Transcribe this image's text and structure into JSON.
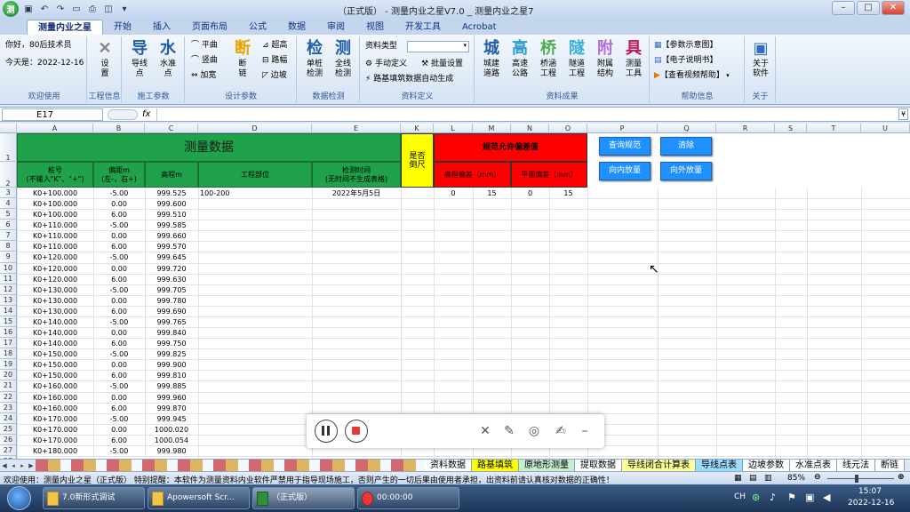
{
  "window": {
    "title": "（正式版） - 测量内业之星V7.0 _ 测量内业之星7",
    "quick_access": [
      "save-icon",
      "undo-icon",
      "redo-icon",
      "folder-icon",
      "printer-icon",
      "preview-icon"
    ],
    "controls": [
      "–",
      "□",
      "✕"
    ]
  },
  "tabs": [
    "测量内业之星",
    "开始",
    "插入",
    "页面布局",
    "公式",
    "数据",
    "审阅",
    "视图",
    "开发工具",
    "Acrobat"
  ],
  "ribbon": {
    "welcome": {
      "line1": "你好，80后技术员",
      "line2": "今天是：2022-12-16",
      "label": "欢迎使用"
    },
    "engineering": {
      "btn": "设\n置",
      "label": "工程信息"
    },
    "survey": {
      "daoxian": "导线\n点",
      "shuizhun": "水准\n点",
      "label": "施工参数"
    },
    "design": {
      "items": [
        "平曲",
        "竖曲",
        "加宽"
      ],
      "duanlian": "断\n链",
      "chaogao": "超高",
      "lufu": "路幅",
      "bianpo": "边坡",
      "label": "设计参数"
    },
    "check": {
      "danzhuang": "单桩\n检测",
      "quanxian": "全线\n检测",
      "label": "数据检测"
    },
    "define": {
      "type_label": "资料类型",
      "manual": "手动定义",
      "batch": "批量设置",
      "auto": "路基填筑数据自动生成",
      "label": "资料定义"
    },
    "results": {
      "items": [
        "城建\n道路",
        "高速\n公路",
        "桥涵\n工程",
        "隧道\n工程",
        "附属\n结构",
        "测量\n工具"
      ],
      "icons": [
        "城",
        "高",
        "桥",
        "隧",
        "附",
        "具"
      ],
      "label": "资料成果"
    },
    "help": {
      "items": [
        "【参数示意图】",
        "【电子说明书】",
        "【查看视频帮助】"
      ],
      "label": "帮助信息"
    },
    "about": {
      "btn": "关于\n软件",
      "label": "关于"
    }
  },
  "formula_bar": {
    "name_box": "E17",
    "fx": "fx",
    "value": ""
  },
  "columns": [
    "A",
    "B",
    "C",
    "D",
    "E",
    "K",
    "L",
    "M",
    "N",
    "O",
    "P",
    "Q",
    "R",
    "S",
    "T",
    "U"
  ],
  "sheet": {
    "title": "测量数据",
    "headers": {
      "station": "桩号\n(不输入\"K\"、\"+\")",
      "offset": "偏距m\n(左-，右+)",
      "elev": "高程m",
      "part": "工程部位",
      "time": "检测时间\n(无时间不生成表格)",
      "ruler": "是否\n倒尺",
      "tol_title": "规范允许偏差值",
      "tol_elev": "高程偏差（mm）",
      "tol_plane": "平面偏差（mm）"
    },
    "first_row_extra": {
      "part": "100-200",
      "time": "2022年5月5日",
      "tol": [
        "0",
        "15",
        "0",
        "15"
      ]
    },
    "buttons": [
      "查询规范",
      "清除",
      "向内放量",
      "向外放量"
    ],
    "rows": [
      {
        "r": "3",
        "a": "K0+100.000",
        "b": "-5.00",
        "c": "999.525"
      },
      {
        "r": "4",
        "a": "K0+100.000",
        "b": "0.00",
        "c": "999.600"
      },
      {
        "r": "5",
        "a": "K0+100.000",
        "b": "6.00",
        "c": "999.510"
      },
      {
        "r": "6",
        "a": "K0+110.000",
        "b": "-5.00",
        "c": "999.585"
      },
      {
        "r": "7",
        "a": "K0+110.000",
        "b": "0.00",
        "c": "999.660"
      },
      {
        "r": "8",
        "a": "K0+110.000",
        "b": "6.00",
        "c": "999.570"
      },
      {
        "r": "9",
        "a": "K0+120.000",
        "b": "-5.00",
        "c": "999.645"
      },
      {
        "r": "10",
        "a": "K0+120.000",
        "b": "0.00",
        "c": "999.720"
      },
      {
        "r": "11",
        "a": "K0+120.000",
        "b": "6.00",
        "c": "999.630"
      },
      {
        "r": "12",
        "a": "K0+130.000",
        "b": "-5.00",
        "c": "999.705"
      },
      {
        "r": "13",
        "a": "K0+130.000",
        "b": "0.00",
        "c": "999.780"
      },
      {
        "r": "14",
        "a": "K0+130.000",
        "b": "6.00",
        "c": "999.690"
      },
      {
        "r": "15",
        "a": "K0+140.000",
        "b": "-5.00",
        "c": "999.765"
      },
      {
        "r": "16",
        "a": "K0+140.000",
        "b": "0.00",
        "c": "999.840"
      },
      {
        "r": "17",
        "a": "K0+140.000",
        "b": "6.00",
        "c": "999.750"
      },
      {
        "r": "18",
        "a": "K0+150.000",
        "b": "-5.00",
        "c": "999.825"
      },
      {
        "r": "19",
        "a": "K0+150.000",
        "b": "0.00",
        "c": "999.900"
      },
      {
        "r": "20",
        "a": "K0+150.000",
        "b": "6.00",
        "c": "999.810"
      },
      {
        "r": "21",
        "a": "K0+160.000",
        "b": "-5.00",
        "c": "999.885"
      },
      {
        "r": "22",
        "a": "K0+160.000",
        "b": "0.00",
        "c": "999.960"
      },
      {
        "r": "23",
        "a": "K0+160.000",
        "b": "6.00",
        "c": "999.870"
      },
      {
        "r": "24",
        "a": "K0+170.000",
        "b": "-5.00",
        "c": "999.945"
      },
      {
        "r": "25",
        "a": "K0+170.000",
        "b": "0.00",
        "c": "1000.020"
      },
      {
        "r": "26",
        "a": "K0+170.000",
        "b": "6.00",
        "c": "1000.054"
      },
      {
        "r": "27",
        "a": "K0+180.000",
        "b": "-5.00",
        "c": "999.980"
      },
      {
        "r": "28",
        "a": "K0+180.000",
        "b": "0.00",
        "c": "1000.080"
      },
      {
        "r": "29",
        "a": "K0+180.000",
        "b": "6.00",
        "c": "1000.200"
      }
    ]
  },
  "sheet_tabs": [
    "资料数据",
    "路基填筑",
    "原地形测量",
    "提取数据",
    "导线闭合计算表",
    "导线点表",
    "边坡参数",
    "水准点表",
    "线元法",
    "断链"
  ],
  "sheet_tab_colors": [
    "#ffffff",
    "#ffff00",
    "#c6efce",
    "#ffffff",
    "#ffff99",
    "#9ddcff",
    "#ffffff",
    "#ffffff",
    "#ffffff",
    "#ffffff"
  ],
  "status": {
    "message": "欢迎使用：测量内业之星（正式版）   特别提醒：本软件为测量资料内业软件严禁用于指导现场施工，否则产生的一切后果由使用者承担，出资料前请认真核对数据的正确性！",
    "zoom": "85%"
  },
  "taskbar": {
    "items": [
      "7.0新形式调试",
      "Apowersoft Scr...",
      "（正式版）",
      "00:00:00"
    ],
    "lang": "CH",
    "time": "15:07",
    "date": "2022-12-16"
  },
  "colors": {
    "green_header": "#1fa24a",
    "yellow": "#ffff00",
    "red": "#ff0000",
    "blue_button": "#1e90ff"
  }
}
